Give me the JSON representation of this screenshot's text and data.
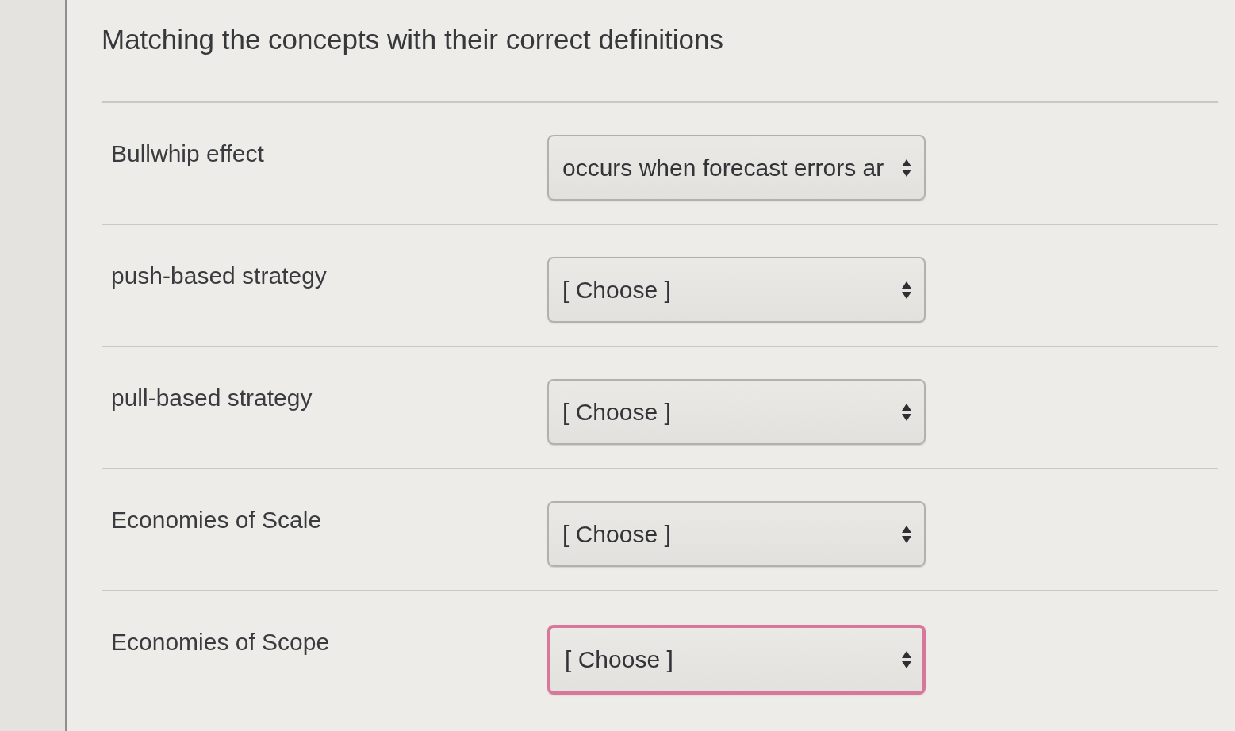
{
  "title": "Matching the concepts with their correct definitions",
  "matches": [
    {
      "term": "Bullwhip effect",
      "answer": "occurs when forecast errors ar",
      "focused": false
    },
    {
      "term": "push-based strategy",
      "answer": "[ Choose ]",
      "focused": false
    },
    {
      "term": "pull-based strategy",
      "answer": "[ Choose ]",
      "focused": false
    },
    {
      "term": "Economies of Scale",
      "answer": "[ Choose ]",
      "focused": false
    },
    {
      "term": "Economies of Scope",
      "answer": "[ Choose ]",
      "focused": true
    }
  ]
}
